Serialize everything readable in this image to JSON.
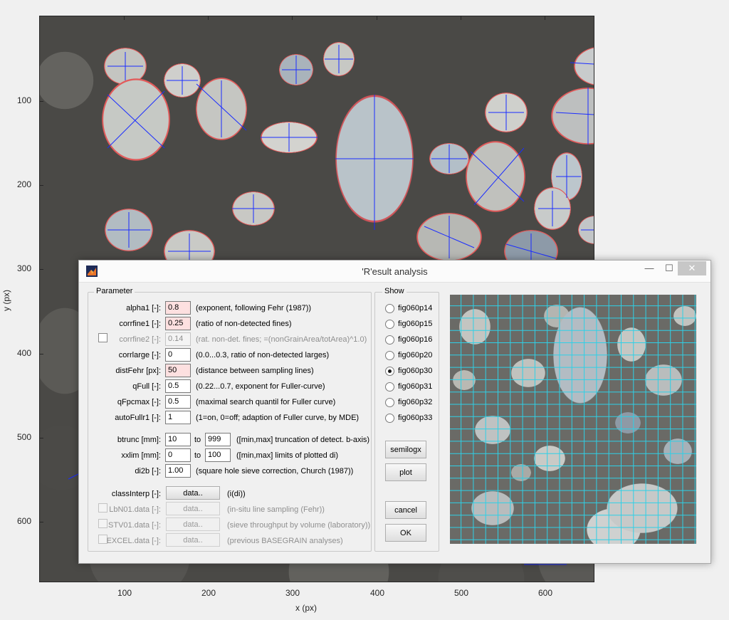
{
  "figure": {
    "xticks": [
      "100",
      "200",
      "300",
      "400",
      "500",
      "600"
    ],
    "yticks": [
      "100",
      "200",
      "300",
      "400",
      "500",
      "600"
    ],
    "xlabel": "x (px)",
    "ylabel": "y (px)",
    "colors": {
      "grain_outline": "#e25a5a",
      "axis_lines": "#1a2cff"
    }
  },
  "dialog": {
    "title": "'R'esult analysis",
    "window_buttons": {
      "minimize": "—",
      "maximize": "☐",
      "close": "✕"
    },
    "parameter": {
      "legend": "Parameter",
      "rows": [
        {
          "label": "alpha1 [-]:",
          "value": "0.8",
          "desc": "(exponent, following Fehr (1987))"
        },
        {
          "label": "corrfine1 [-]:",
          "value": "0.25",
          "desc": "(ratio of non-detected fines)"
        },
        {
          "label": "corrfine2 [-]:",
          "value": "0.14",
          "desc": "(rat. non-det. fines; =(nonGrainArea/totArea)^1.0)"
        },
        {
          "label": "corrlarge [-]:",
          "value": "0",
          "desc": "(0.0...0.3, ratio of non-detected larges)"
        },
        {
          "label": "distFehr [px]:",
          "value": "50",
          "desc": "(distance between sampling lines)"
        },
        {
          "label": "qFull [-]:",
          "value": "0.5",
          "desc": "(0.22...0.7, exponent for Fuller-curve)"
        },
        {
          "label": "qFpcmax [-]:",
          "value": "0.5",
          "desc": "(maximal search quantil for Fuller curve)"
        },
        {
          "label": "autoFullr1 [-]:",
          "value": "1",
          "desc": "(1=on, 0=off; adaption of Fuller curve, by MDE)"
        }
      ],
      "ranges": [
        {
          "label": "btrunc [mm]:",
          "min": "10",
          "to": "to",
          "max": "999",
          "desc": "([min,max] truncation of detect. b-axis)"
        },
        {
          "label": "xxlim [mm]:",
          "min": "0",
          "to": "to",
          "max": "100",
          "desc": "([min,max] limits of plotted di)"
        }
      ],
      "di2b": {
        "label": "di2b [-]:",
        "value": "1.00",
        "desc": "(square hole sieve correction, Church (1987))"
      },
      "data_rows": [
        {
          "label": "classInterp [-]:",
          "button": "data..",
          "desc": "(i(di))"
        },
        {
          "label": "LbN01.data [-]:",
          "button": "data..",
          "desc": "(in-situ line sampling (Fehr))"
        },
        {
          "label": "STV01.data [-]:",
          "button": "data..",
          "desc": "(sieve throughput by volume (laboratory))"
        },
        {
          "label": "EXCEL.data [-]:",
          "button": "data..",
          "desc": "(previous BASEGRAIN analyses)"
        }
      ]
    },
    "show": {
      "legend": "Show",
      "options": [
        "fig060p14",
        "fig060p15",
        "fig060p16",
        "fig060p20",
        "fig060p30",
        "fig060p31",
        "fig060p32",
        "fig060p33"
      ],
      "selected": "fig060p30",
      "buttons": {
        "semilogx": "semilogx",
        "plot": "plot",
        "cancel": "cancel",
        "ok": "OK"
      }
    },
    "preview": {
      "grid_color": "#2fd0e6"
    }
  }
}
